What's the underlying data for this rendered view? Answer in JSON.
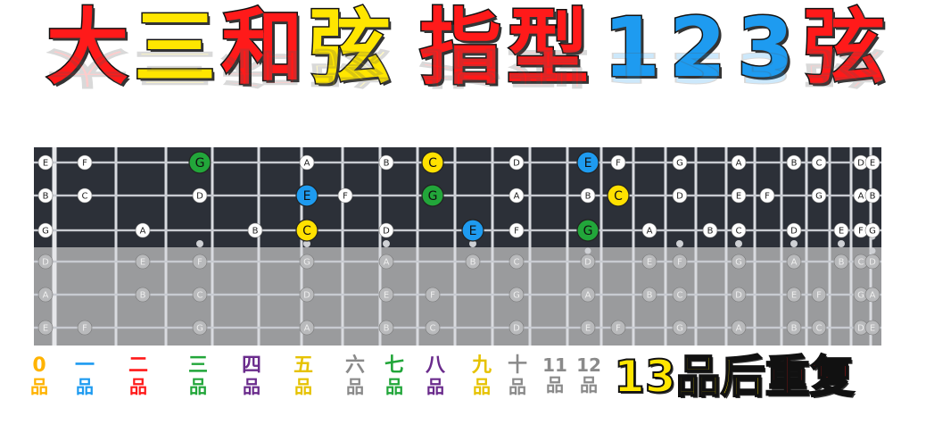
{
  "title": {
    "chars": [
      {
        "text": "大",
        "color": "#ff1a1a"
      },
      {
        "text": "三",
        "color": "#ffe600"
      },
      {
        "text": "和",
        "color": "#ff1a1a"
      },
      {
        "text": "弦",
        "color": "#ffe600"
      },
      {
        "text": "指",
        "color": "#ff1a1a"
      },
      {
        "text": "型",
        "color": "#ff1a1a"
      },
      {
        "text": "1",
        "color": "#1e9bf0"
      },
      {
        "text": "2",
        "color": "#1e9bf0"
      },
      {
        "text": "3",
        "color": "#1e9bf0"
      },
      {
        "text": "弦",
        "color": "#ff1a1a"
      }
    ]
  },
  "fretboard": {
    "colors": {
      "dark_bg": "#2c3038",
      "light_bg": "#9a9b9d",
      "string": "#c8cbd1",
      "fret": "#d9dbe0",
      "nut": "#e6e7ea",
      "C": "#ffe100",
      "E": "#1e9bf0",
      "G": "#22a63a"
    },
    "strings": [
      {
        "highlight": true,
        "notes": [
          [
            "E",
            0
          ],
          [
            "F",
            1
          ],
          [
            "G",
            3
          ],
          [
            "A",
            5
          ],
          [
            "B",
            7
          ],
          [
            "C",
            8
          ],
          [
            "D",
            10
          ],
          [
            "E",
            12
          ],
          [
            "F",
            13
          ],
          [
            "G",
            15
          ],
          [
            "A",
            17
          ],
          [
            "B",
            19
          ],
          [
            "C",
            20
          ],
          [
            "D",
            22
          ],
          [
            "E",
            24
          ]
        ]
      },
      {
        "highlight": true,
        "notes": [
          [
            "B",
            0
          ],
          [
            "C",
            1
          ],
          [
            "D",
            3
          ],
          [
            "E",
            5
          ],
          [
            "F",
            6
          ],
          [
            "G",
            8
          ],
          [
            "A",
            10
          ],
          [
            "B",
            12
          ],
          [
            "C",
            13
          ],
          [
            "D",
            15
          ],
          [
            "E",
            17
          ],
          [
            "F",
            18
          ],
          [
            "G",
            20
          ],
          [
            "A",
            22
          ],
          [
            "B",
            24
          ]
        ]
      },
      {
        "highlight": true,
        "notes": [
          [
            "G",
            0
          ],
          [
            "A",
            2
          ],
          [
            "B",
            4
          ],
          [
            "C",
            5
          ],
          [
            "D",
            7
          ],
          [
            "E",
            9
          ],
          [
            "F",
            10
          ],
          [
            "G",
            12
          ],
          [
            "A",
            14
          ],
          [
            "B",
            16
          ],
          [
            "C",
            17
          ],
          [
            "D",
            19
          ],
          [
            "E",
            21
          ],
          [
            "F",
            22
          ],
          [
            "G",
            24
          ]
        ]
      },
      {
        "highlight": false,
        "notes": [
          [
            "D",
            0
          ],
          [
            "E",
            2
          ],
          [
            "F",
            3
          ],
          [
            "G",
            5
          ],
          [
            "A",
            7
          ],
          [
            "B",
            9
          ],
          [
            "C",
            10
          ],
          [
            "D",
            12
          ],
          [
            "E",
            14
          ],
          [
            "F",
            15
          ],
          [
            "G",
            17
          ],
          [
            "A",
            19
          ],
          [
            "B",
            21
          ],
          [
            "C",
            22
          ],
          [
            "D",
            24
          ]
        ]
      },
      {
        "highlight": false,
        "notes": [
          [
            "A",
            0
          ],
          [
            "B",
            2
          ],
          [
            "C",
            3
          ],
          [
            "D",
            5
          ],
          [
            "E",
            7
          ],
          [
            "F",
            8
          ],
          [
            "G",
            10
          ],
          [
            "A",
            12
          ],
          [
            "B",
            14
          ],
          [
            "C",
            15
          ],
          [
            "D",
            17
          ],
          [
            "E",
            19
          ],
          [
            "F",
            20
          ],
          [
            "G",
            22
          ],
          [
            "A",
            24
          ]
        ]
      },
      {
        "highlight": false,
        "notes": [
          [
            "E",
            0
          ],
          [
            "F",
            1
          ],
          [
            "G",
            3
          ],
          [
            "A",
            5
          ],
          [
            "B",
            7
          ],
          [
            "C",
            8
          ],
          [
            "D",
            10
          ],
          [
            "E",
            12
          ],
          [
            "F",
            13
          ],
          [
            "G",
            15
          ],
          [
            "A",
            17
          ],
          [
            "B",
            19
          ],
          [
            "C",
            20
          ],
          [
            "D",
            22
          ],
          [
            "E",
            24
          ]
        ]
      }
    ],
    "highlighted_positions": [
      {
        "string": 0,
        "fret": 3,
        "note": "G"
      },
      {
        "string": 0,
        "fret": 8,
        "note": "C"
      },
      {
        "string": 0,
        "fret": 12,
        "note": "E"
      },
      {
        "string": 1,
        "fret": 5,
        "note": "E"
      },
      {
        "string": 1,
        "fret": 8,
        "note": "G"
      },
      {
        "string": 1,
        "fret": 13,
        "note": "C"
      },
      {
        "string": 2,
        "fret": 5,
        "note": "C"
      },
      {
        "string": 2,
        "fret": 9,
        "note": "E"
      },
      {
        "string": 2,
        "fret": 12,
        "note": "G"
      }
    ],
    "inlay_frets": [
      3,
      5,
      7,
      9,
      15,
      17,
      19,
      21
    ],
    "double_inlay_frets": [
      12,
      24
    ]
  },
  "fret_labels": [
    {
      "top": "0",
      "bottom": "品",
      "color": "#ffb300"
    },
    {
      "top": "一",
      "bottom": "品",
      "color": "#1e9bf0"
    },
    {
      "top": "二",
      "bottom": "品",
      "color": "#ff1a1a"
    },
    {
      "top": "三",
      "bottom": "品",
      "color": "#22a63a"
    },
    {
      "top": "四",
      "bottom": "品",
      "color": "#6a2b8c"
    },
    {
      "top": "五",
      "bottom": "品",
      "color": "#e6c200"
    },
    {
      "top": "六",
      "bottom": "品",
      "color": "#8a8a8a"
    },
    {
      "top": "七",
      "bottom": "品",
      "color": "#22a63a"
    },
    {
      "top": "八",
      "bottom": "品",
      "color": "#6a2b8c"
    },
    {
      "top": "九",
      "bottom": "品",
      "color": "#e6c200"
    },
    {
      "top": "十",
      "bottom": "品",
      "color": "#8a8a8a"
    },
    {
      "top": "11",
      "bottom": "品",
      "color": "#8a8a8a"
    },
    {
      "top": "12",
      "bottom": "品",
      "color": "#8a8a8a"
    }
  ],
  "repeat_note": {
    "text1": "13品后",
    "text2": "重复",
    "color1": "#ffe600",
    "color2": "#ff1a1a"
  }
}
